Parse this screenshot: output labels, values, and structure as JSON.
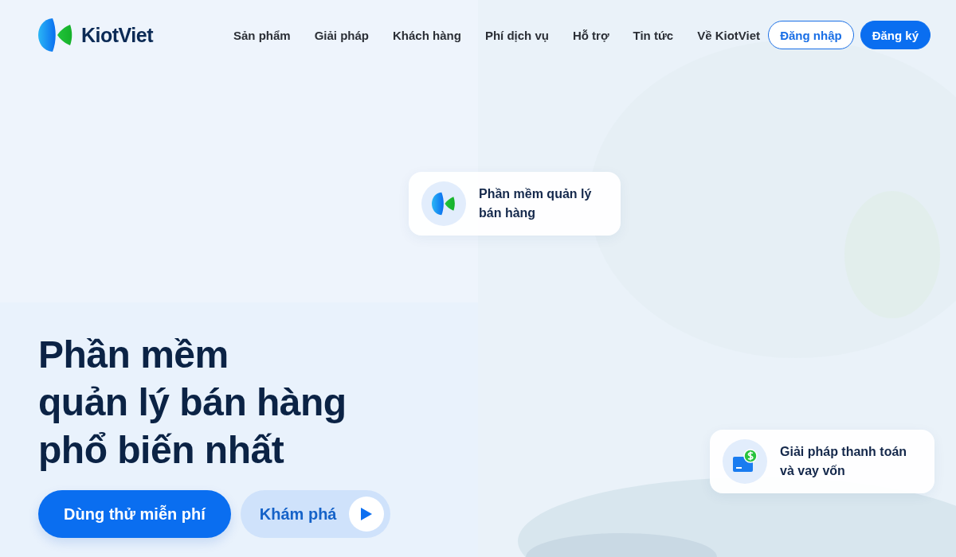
{
  "header": {
    "logo": {
      "name": "KiotViet"
    },
    "nav": [
      {
        "label": "Sản phẩm"
      },
      {
        "label": "Giải pháp"
      },
      {
        "label": "Khách hàng"
      },
      {
        "label": "Phí dịch vụ"
      },
      {
        "label": "Hỗ trợ"
      },
      {
        "label": "Tin tức"
      },
      {
        "label": "Về KiotViet"
      }
    ],
    "actions": [
      {
        "label": "Đăng nhập",
        "kind": "outline"
      },
      {
        "label": "Đăng ký",
        "kind": "filled"
      }
    ]
  },
  "floating_cards": [
    {
      "text": "Phần mềm quản lý bán hàng",
      "kind": "logo"
    },
    {
      "text": "Giải pháp thanh toán và vay vốn",
      "kind": "payment"
    }
  ],
  "hero": {
    "title_lines": [
      "Phần mềm",
      "quản lý bán hàng",
      "phổ biến nhất"
    ],
    "primary_button": "Dùng thử miễn phí",
    "secondary_button": "Khám phá"
  }
}
